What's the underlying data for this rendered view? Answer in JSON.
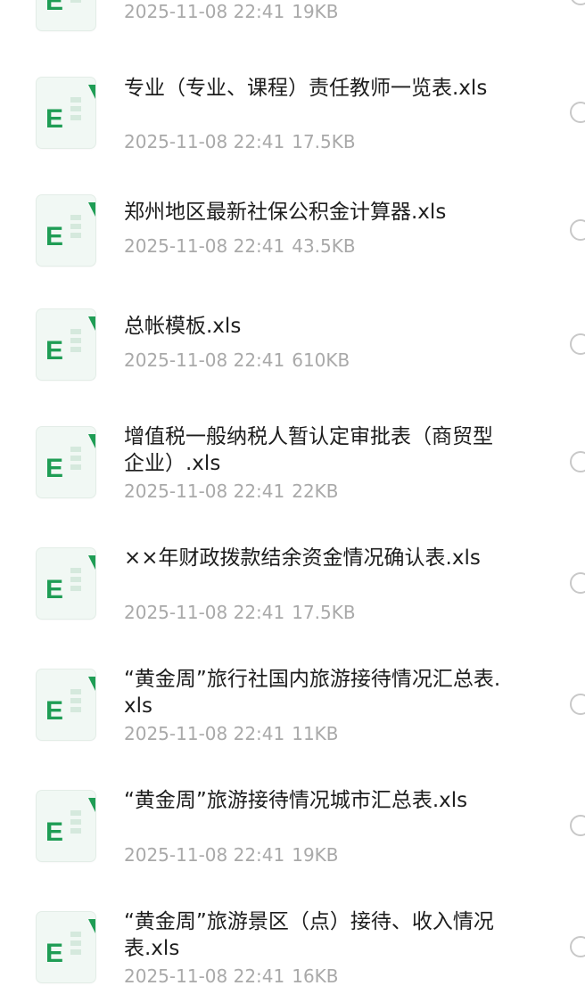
{
  "files": [
    {
      "name": "",
      "date": "2025-11-08 22:41",
      "size": "19KB",
      "icon": "excel-file-icon"
    },
    {
      "name": "专业（专业、课程）责任教师一览表.xls",
      "date": "2025-11-08 22:41",
      "size": "17.5KB",
      "icon": "excel-file-icon"
    },
    {
      "name": "郑州地区最新社保公积金计算器.xls",
      "date": "2025-11-08 22:41",
      "size": "43.5KB",
      "icon": "excel-file-icon"
    },
    {
      "name": "总帐模板.xls",
      "date": "2025-11-08 22:41",
      "size": "610KB",
      "icon": "excel-file-icon"
    },
    {
      "name": "增值税一般纳税人暂认定审批表（商贸型企业）.xls",
      "date": "2025-11-08 22:41",
      "size": "22KB",
      "icon": "excel-file-icon"
    },
    {
      "name": "××年财政拨款结余资金情况确认表.xls",
      "date": "2025-11-08 22:41",
      "size": "17.5KB",
      "icon": "excel-file-icon"
    },
    {
      "name": "“黄金周”旅行社国内旅游接待情况汇总表.xls",
      "date": "2025-11-08 22:41",
      "size": "11KB",
      "icon": "excel-file-icon"
    },
    {
      "name": "“黄金周”旅游接待情况城市汇总表.xls",
      "date": "2025-11-08 22:41",
      "size": "19KB",
      "icon": "excel-file-icon"
    },
    {
      "name": "“黄金周”旅游景区（点）接待、收入情况表.xls",
      "date": "2025-11-08 22:41",
      "size": "16KB",
      "icon": "excel-file-icon"
    }
  ],
  "colors": {
    "excel_green": "#1f9d55",
    "icon_bg": "#f1f8f4",
    "meta_text": "#a9a9a9",
    "radio_border": "#c8c8c8"
  }
}
